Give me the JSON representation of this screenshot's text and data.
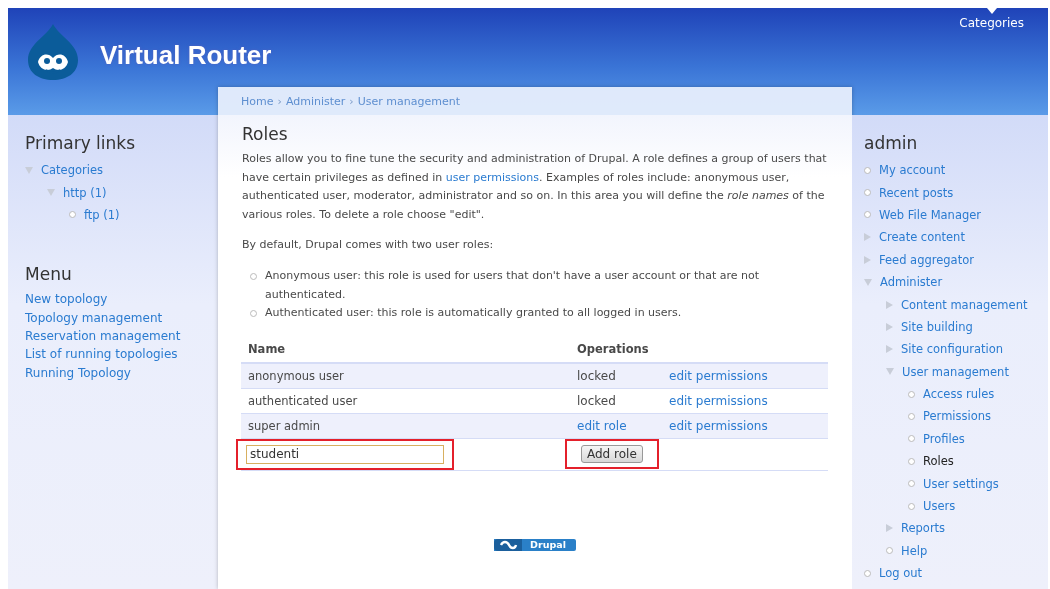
{
  "header": {
    "site_name": "Virtual Router",
    "top_links": [
      {
        "label": "Categories"
      }
    ]
  },
  "breadcrumb": {
    "separator": "›",
    "items": [
      "Home",
      "Administer",
      "User management"
    ]
  },
  "left_sidebar": [
    {
      "title": "Primary links",
      "kind": "tree",
      "items": [
        {
          "label": "Categories",
          "expanded": true,
          "children": [
            {
              "label": "http (1)",
              "expanded": true,
              "children": [
                {
                  "label": "ftp (1)"
                }
              ]
            }
          ]
        }
      ]
    },
    {
      "title": "Menu",
      "kind": "links",
      "items": [
        {
          "label": "New topology"
        },
        {
          "label": "Topology management"
        },
        {
          "label": "Reservation management"
        },
        {
          "label": "List of running topologies"
        },
        {
          "label": "Running Topology"
        }
      ]
    }
  ],
  "content": {
    "title": "Roles",
    "intro": "Roles allow you to fine tune the security and administration of Drupal. A role defines a group of users that have certain privileges as defined in ",
    "intro_link": "user permissions",
    "intro_rest": ". Examples of roles include: anonymous user, authenticated user, moderator, administrator and so on. In this area you will define the *role names* of the various roles. To delete a role choose \"edit\".",
    "default_note": "By default, Drupal comes with two user roles:",
    "bullets": [
      "Anonymous user: this role is used for users that don't have a user account or that are not authenticated.",
      "Authenticated user: this role is automatically granted to all logged in users."
    ],
    "table": {
      "columns": [
        "Name",
        "Operations"
      ],
      "rows": [
        {
          "name": "anonymous user",
          "operations": [
            {
              "kind": "text",
              "label": "locked"
            },
            {
              "kind": "link",
              "label": "edit permissions"
            }
          ]
        },
        {
          "name": "authenticated user",
          "operations": [
            {
              "kind": "text",
              "label": "locked"
            },
            {
              "kind": "link",
              "label": "edit permissions"
            }
          ]
        },
        {
          "name": "super admin",
          "operations": [
            {
              "kind": "link",
              "label": "edit role"
            },
            {
              "kind": "link",
              "label": "edit permissions"
            }
          ]
        }
      ],
      "new_role": {
        "value": "studenti",
        "highlighted": true
      },
      "add_button": {
        "label": "Add role",
        "highlighted": true
      }
    }
  },
  "footer": {
    "badge": "Drupal"
  },
  "right_sidebar": {
    "title": "admin",
    "items": [
      {
        "label": "My account",
        "selected": false
      },
      {
        "label": "Recent posts",
        "selected": false
      },
      {
        "label": "Web File Manager",
        "selected": false
      },
      {
        "label": "Create content",
        "expanded": false,
        "selected": false
      },
      {
        "label": "Feed aggregator",
        "expanded": false,
        "selected": false
      },
      {
        "label": "Administer",
        "expanded": true,
        "selected": false,
        "children": [
          {
            "label": "Content management",
            "expanded": false,
            "selected": false
          },
          {
            "label": "Site building",
            "expanded": false,
            "selected": false
          },
          {
            "label": "Site configuration",
            "expanded": false,
            "selected": false
          },
          {
            "label": "User management",
            "expanded": true,
            "selected": false,
            "children": [
              {
                "label": "Access rules",
                "selected": false
              },
              {
                "label": "Permissions",
                "selected": false
              },
              {
                "label": "Profiles",
                "selected": false
              },
              {
                "label": "Roles",
                "selected": true
              },
              {
                "label": "User settings",
                "selected": false
              },
              {
                "label": "Users",
                "selected": false
              }
            ]
          },
          {
            "label": "Reports",
            "expanded": false,
            "selected": false
          },
          {
            "label": "Help",
            "selected": false
          }
        ]
      },
      {
        "label": "Log out",
        "selected": false
      }
    ]
  }
}
